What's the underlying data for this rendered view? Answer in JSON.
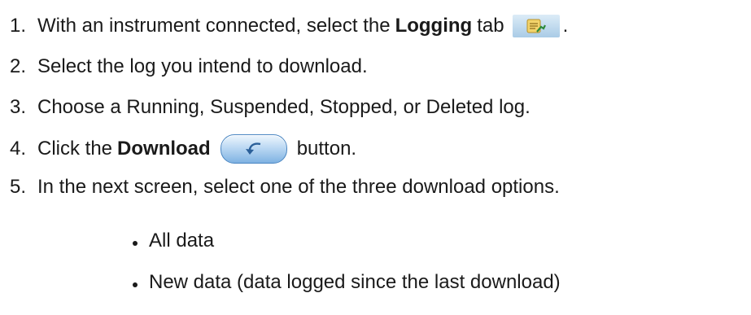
{
  "steps": [
    {
      "number": "1.",
      "pre": "With an instrument connected, select the ",
      "bold": "Logging",
      "post": " tab",
      "icon": "logging-tab-icon",
      "trail": "."
    },
    {
      "number": "2.",
      "text": "Select the log you intend to download."
    },
    {
      "number": "3.",
      "text": "Choose a Running, Suspended, Stopped, or Deleted log."
    },
    {
      "number": "4.",
      "pre": "Click the ",
      "bold": "Download",
      "icon": "download-button-icon",
      "post": "button."
    },
    {
      "number": "5.",
      "text": "In the next screen, select one of the three download options."
    }
  ],
  "options": [
    "All data",
    "New data (data logged since the last download)"
  ],
  "colors": {
    "text": "#1a1a1a",
    "button_accent": "#4a86c2",
    "tab_bg": "#a9cbe6"
  }
}
